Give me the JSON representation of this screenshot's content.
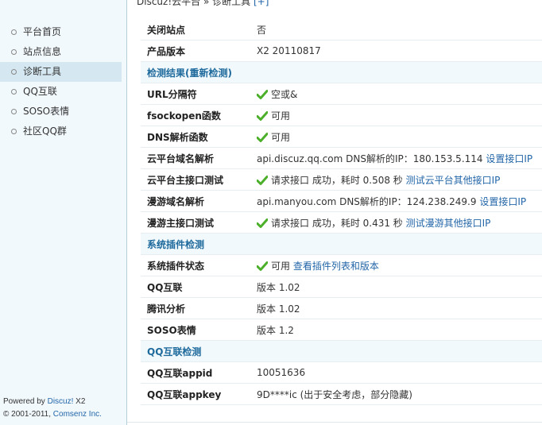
{
  "header": {
    "breadcrumb": "Discuz!云平台 » 诊断工具",
    "add_label": "[+]"
  },
  "sidebar": {
    "items": [
      {
        "label": "平台首页"
      },
      {
        "label": "站点信息"
      },
      {
        "label": "诊断工具"
      },
      {
        "label": "QQ互联"
      },
      {
        "label": "SOSO表情"
      },
      {
        "label": "社区QQ群"
      }
    ],
    "active_index": 2,
    "footer": {
      "powered_by": "Powered by ",
      "product": "Discuz!",
      "product_version": " X2",
      "copyright_prefix": "© 2001-2011, ",
      "company": "Comsenz Inc."
    }
  },
  "info": {
    "site_closed_label": "关闭站点",
    "site_closed_value": "否",
    "product_version_label": "产品版本",
    "product_version_value": "X2 20110817"
  },
  "check": {
    "section_title": "检测结果",
    "recheck_label": "(重新检测)",
    "url_sep_label": "URL分隔符",
    "url_sep_value": "空或&",
    "fsockopen_label": "fsockopen函数",
    "fsockopen_value": "可用",
    "dns_label": "DNS解析函数",
    "dns_value": "可用",
    "cloud_dns_label": "云平台域名解析",
    "cloud_dns_value": "api.discuz.qq.com DNS解析的IP：180.153.5.114",
    "cloud_dns_link": "设置接口IP",
    "cloud_api_label": "云平台主接口测试",
    "cloud_api_value": "请求接口 成功，耗时 0.508 秒",
    "cloud_api_link": "测试云平台其他接口IP",
    "manyou_dns_label": "漫游域名解析",
    "manyou_dns_value": "api.manyou.com DNS解析的IP：124.238.249.9",
    "manyou_dns_link": "设置接口IP",
    "manyou_api_label": "漫游主接口测试",
    "manyou_api_value": "请求接口 成功，耗时 0.431 秒",
    "manyou_api_link": "测试漫游其他接口IP"
  },
  "plugins": {
    "section_title": "系统插件检测",
    "status_label": "系统插件状态",
    "status_value": "可用",
    "status_link": "查看插件列表和版本",
    "qq_label": "QQ互联",
    "qq_value": "版本 1.02",
    "tencent_label": "腾讯分析",
    "tencent_value": "版本 1.02",
    "soso_label": "SOSO表情",
    "soso_value": "版本 1.2"
  },
  "qqconnect": {
    "section_title": "QQ互联检测",
    "appid_label": "QQ互联appid",
    "appid_value": "10051636",
    "appkey_label": "QQ互联appkey",
    "appkey_value": "9D****ic (出于安全考虑，部分隐藏)"
  },
  "colors": {
    "accent": "#1e6a9c",
    "link": "#2366a8",
    "ok": "#4caf2a",
    "sidebar_bg": "#f2f9fd",
    "sidebar_active": "#d5e8f1"
  }
}
